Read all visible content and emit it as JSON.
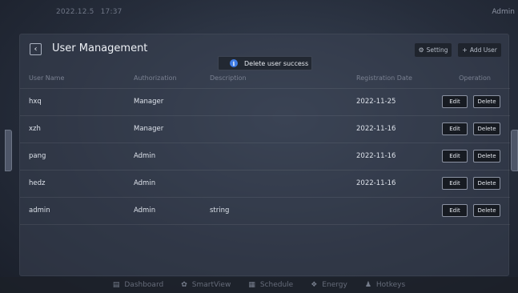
{
  "topbar": {
    "date": "2022.12.5",
    "time": "17:37",
    "user": "Admin"
  },
  "page": {
    "title": "User Management",
    "back_icon": "chevron-left-icon",
    "setting_label": "Setting",
    "setting_icon": "gear-icon",
    "add_user_label": "Add User",
    "add_user_icon": "plus-icon"
  },
  "toast": {
    "icon": "info-icon",
    "message": "Delete user success"
  },
  "table": {
    "columns": [
      "User Name",
      "Authorization",
      "Description",
      "Registration Date",
      "Operation"
    ],
    "rows": [
      {
        "name": "hxq",
        "auth": "Manager",
        "desc": "",
        "date": "2022-11-25"
      },
      {
        "name": "xzh",
        "auth": "Manager",
        "desc": "",
        "date": "2022-11-16"
      },
      {
        "name": "pang",
        "auth": "Admin",
        "desc": "",
        "date": "2022-11-16"
      },
      {
        "name": "hedz",
        "auth": "Admin",
        "desc": "",
        "date": "2022-11-16"
      },
      {
        "name": "admin",
        "auth": "Admin",
        "desc": "string",
        "date": ""
      }
    ],
    "edit_label": "Edit",
    "delete_label": "Delete"
  },
  "nav": [
    {
      "label": "Dashboard",
      "icon": "dashboard-icon"
    },
    {
      "label": "SmartView",
      "icon": "smartview-icon"
    },
    {
      "label": "Schedule",
      "icon": "calendar-icon"
    },
    {
      "label": "Energy",
      "icon": "energy-icon"
    },
    {
      "label": "Hotkeys",
      "icon": "person-icon"
    }
  ],
  "colors": {
    "accent": "#3e7be4",
    "background": "#262d3b",
    "panel": "#3a4252"
  }
}
